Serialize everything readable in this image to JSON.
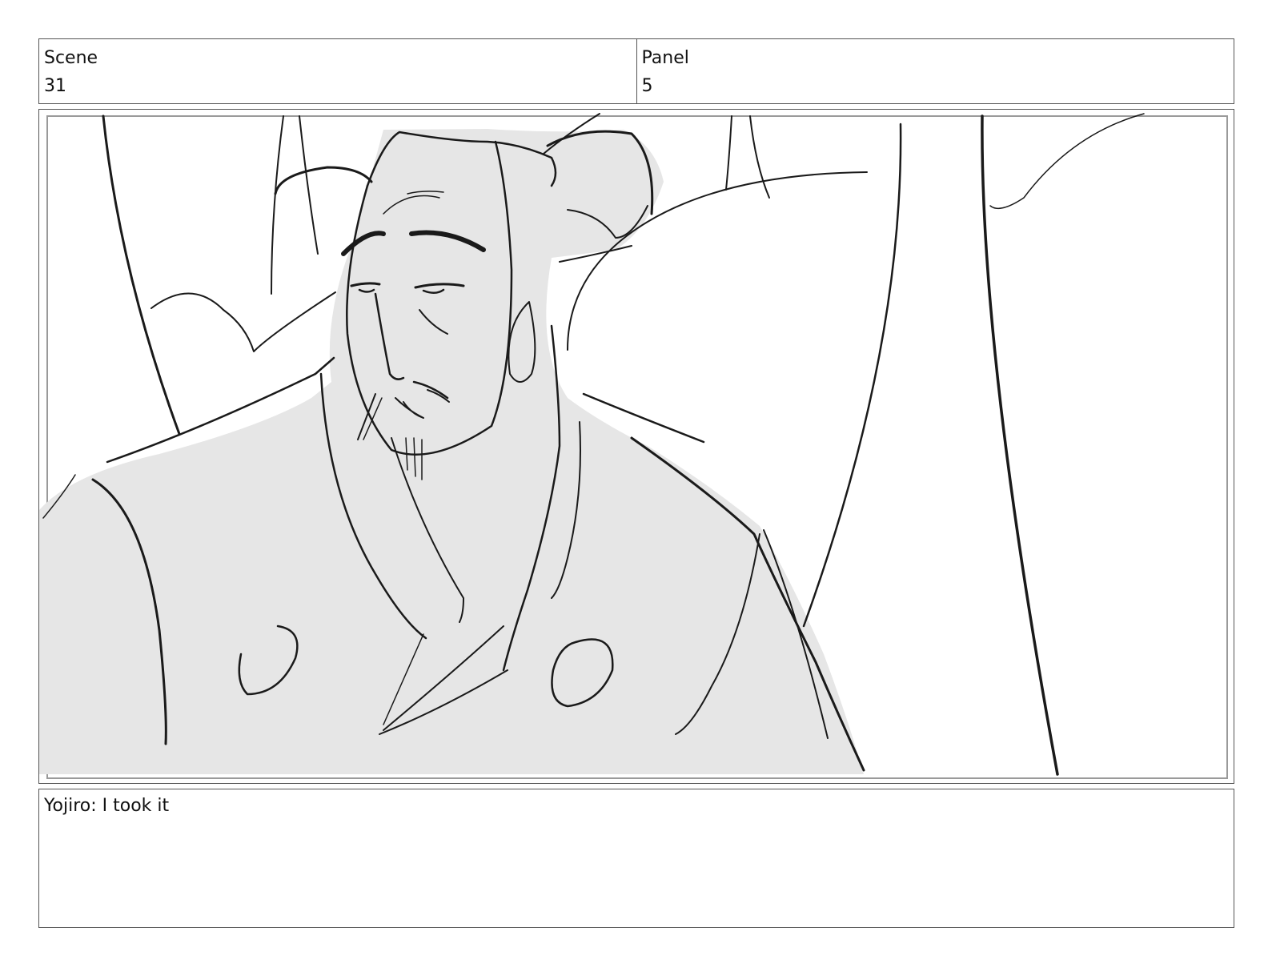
{
  "header": {
    "scene_label": "Scene",
    "scene_value": "31",
    "panel_label": "Panel",
    "panel_value": "5"
  },
  "panel": {
    "image_subject": "storyboard-sketch-samurai-yojiro"
  },
  "caption": {
    "text": "Yojiro: I took it"
  },
  "colors": {
    "border": "#555555",
    "ink": "#1a1a1a",
    "fill": "#e6e6e6"
  }
}
